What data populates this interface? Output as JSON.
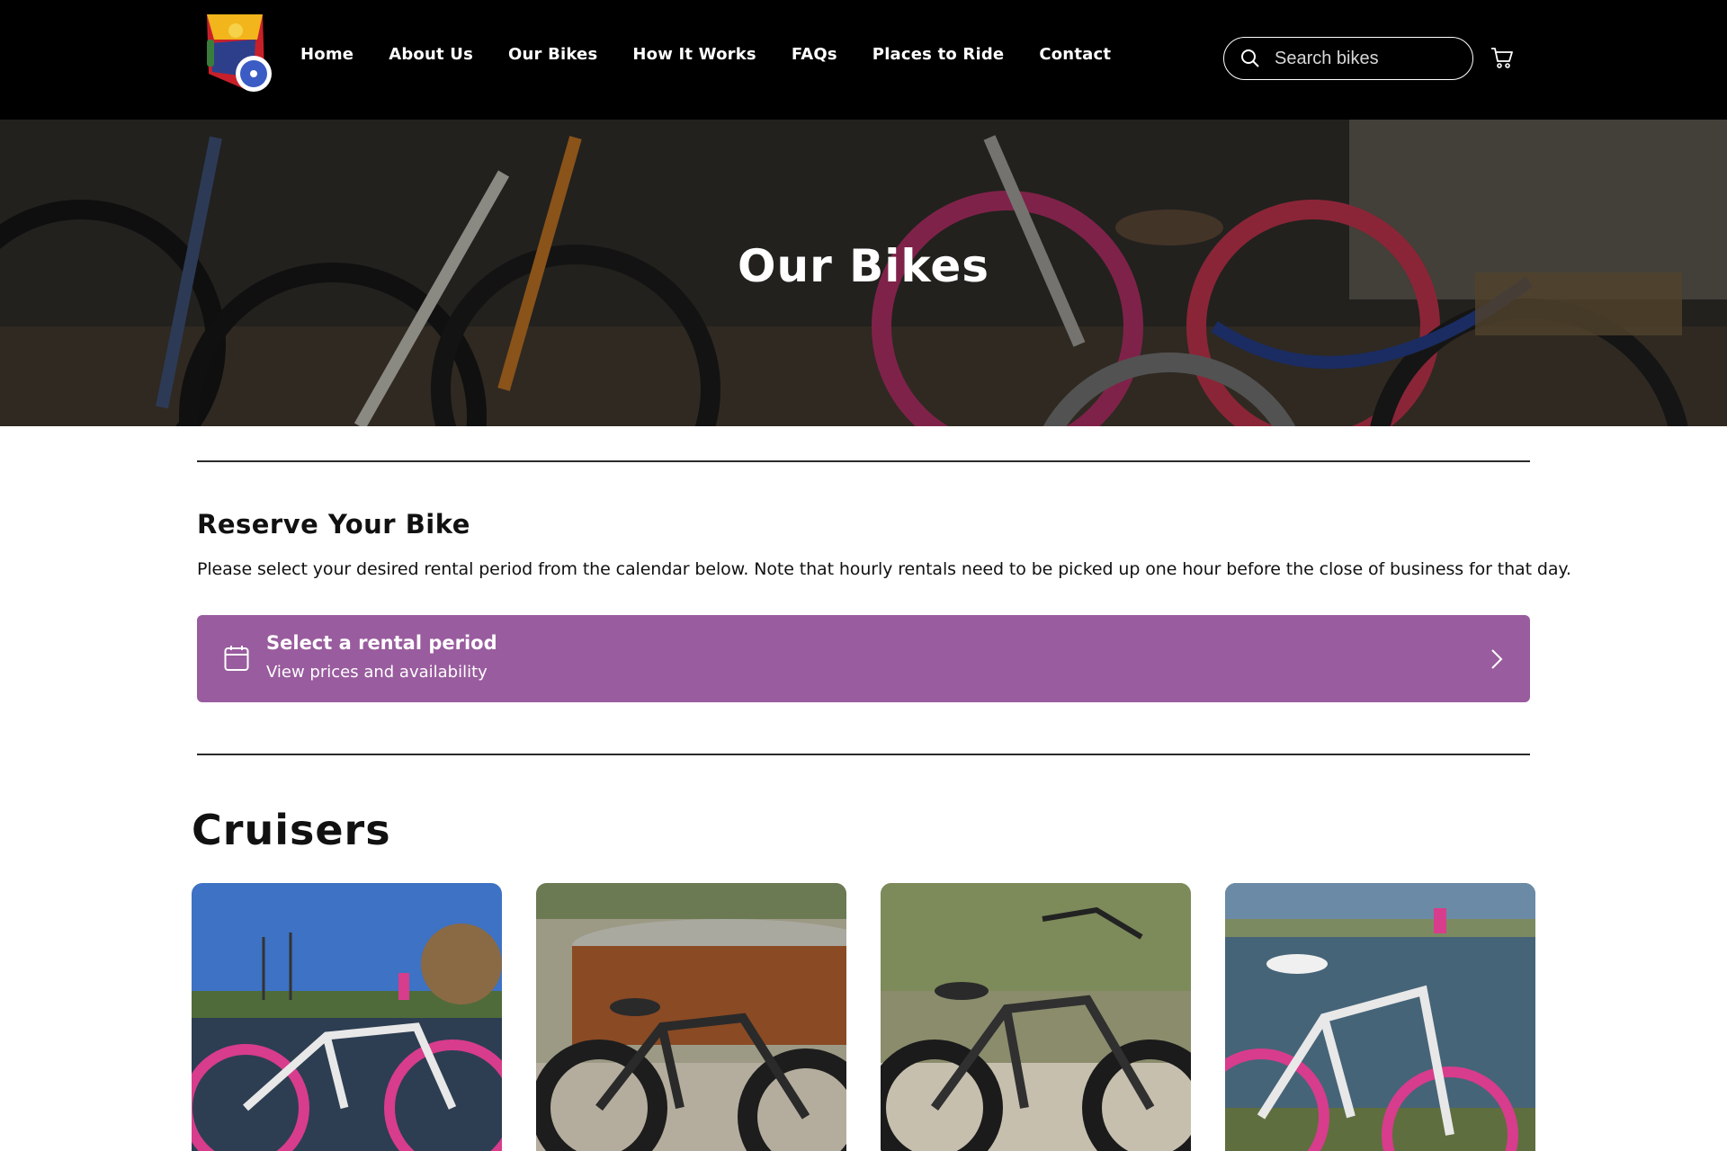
{
  "header": {
    "nav": [
      "Home",
      "About Us",
      "Our Bikes",
      "How It Works",
      "FAQs",
      "Places to Ride",
      "Contact"
    ],
    "search_placeholder": "Search bikes",
    "icons": {
      "search": "search-icon",
      "cart": "cart-icon"
    }
  },
  "hero": {
    "title": "Our Bikes"
  },
  "reserve": {
    "title": "Reserve Your Bike",
    "description": "Please select your desired rental period from the calendar below. Note that hourly rentals need to be picked up one hour before the close of business for that day.",
    "button": {
      "title": "Select a rental period",
      "subtitle": "View prices and availability",
      "icon": "calendar-icon",
      "chevron": "chevron-right-icon"
    }
  },
  "cruisers": {
    "title": "Cruisers",
    "cards": [
      {
        "bike_color": "white-pink"
      },
      {
        "bike_color": "black"
      },
      {
        "bike_color": "black"
      },
      {
        "bike_color": "white-pink"
      }
    ]
  },
  "colors": {
    "header_bg": "#000000",
    "accent": "#995c9e",
    "text": "#111111"
  }
}
